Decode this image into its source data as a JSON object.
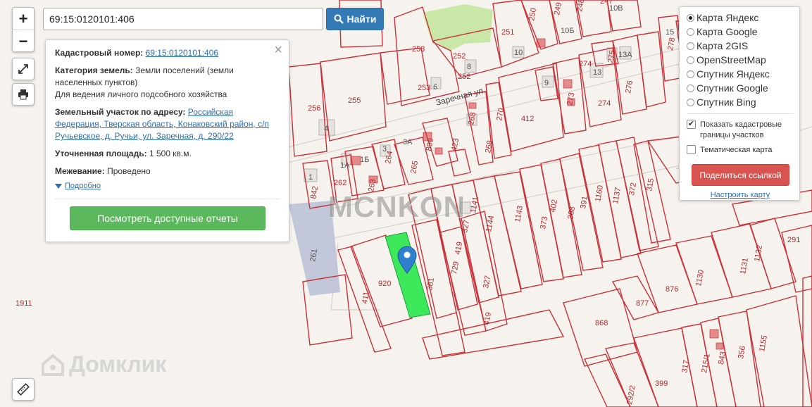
{
  "search": {
    "value": "69:15:0120101:406",
    "button_label": "Найти"
  },
  "zoom": {
    "in_label": "+",
    "out_label": "−"
  },
  "info": {
    "cadastral_label": "Кадастровый номер:",
    "cadastral_value": "69:15:0120101:406",
    "category_label": "Категория земель:",
    "category_value": "Земли поселений (земли населенных пунктов)",
    "use_value": "Для ведения личного подсобного хозяйства",
    "address_label": "Земельный участок по адресу:",
    "address_value": "Российская Федерация, Тверская область, Конаковский район, с/п Ручьевское, д. Ручьи, ул. Заречная, д. 290/22",
    "area_label": "Уточненная площадь:",
    "area_value": "1 500 кв.м.",
    "survey_label": "Межевание:",
    "survey_value": "Проведено",
    "more_label": "Подробно",
    "reports_button": "Посмотреть доступные отчеты",
    "close_symbol": "×"
  },
  "layers": {
    "options": [
      {
        "label": "Карта Яндекс",
        "selected": true
      },
      {
        "label": "Карта Google",
        "selected": false
      },
      {
        "label": "Карта 2GIS",
        "selected": false
      },
      {
        "label": "OpenStreetMap",
        "selected": false
      },
      {
        "label": "Спутник Яндекс",
        "selected": false
      },
      {
        "label": "Спутник Google",
        "selected": false
      },
      {
        "label": "Спутник Bing",
        "selected": false
      }
    ],
    "show_borders_label": "Показать кадастровые границы участков",
    "show_borders_checked": true,
    "thematic_label": "Тематическая карта",
    "thematic_checked": false,
    "share_button": "Поделиться ссылкой",
    "configure_link": "Настроить карту"
  },
  "map": {
    "street_label": "Заречная ул.",
    "watermark": "MCNKON",
    "brand": "Домклик",
    "parcel_labels": [
      "69:15:0120101:406"
    ],
    "numbers": {
      "n253": "253",
      "n252a": "252",
      "n252b": "252",
      "n8": "8",
      "n251": "251",
      "n250": "250",
      "n249": "249",
      "n10b": "10Б",
      "n248": "248",
      "n247": "247",
      "n10v": "10В",
      "n10": "10",
      "n15": "15",
      "n278": "278",
      "n256": "256",
      "n255": "255",
      "n4": "4",
      "n253b": "253",
      "n6": "6",
      "n270": "270",
      "n412": "412",
      "n9": "9",
      "n273": "273",
      "n274a": "274",
      "n274b": "274",
      "n13": "13",
      "n275": "275",
      "n13a": "13А",
      "n276": "276",
      "n268a": "268",
      "n268b": "268",
      "n890": "890",
      "n423": "423",
      "n3": "3",
      "n3a": "3А",
      "n264": "264",
      "n265": "265",
      "n1a": "1А",
      "n1b": "1Б",
      "n1": "1",
      "n842": "842",
      "n262": "262",
      "n263": "263",
      "n315": "315",
      "n372": "372",
      "n1137": "1137",
      "n1160": "1160",
      "n391": "391",
      "n368": "368",
      "n402": "402",
      "n373": "373",
      "n1143": "1143",
      "n1144": "1144",
      "n327a": "327",
      "n1141": "1141",
      "n261": "261",
      "n920": "920",
      "n411": "411",
      "n381": "381",
      "n729": "729",
      "n419a": "419",
      "n419b": "419",
      "n327b": "327",
      "n291": "291",
      "n1132": "1132",
      "n1131": "1131",
      "n1130": "1130",
      "n876": "876",
      "n877": "877",
      "n868": "868",
      "n1911": "1911",
      "n843": "843",
      "n356": "356",
      "n1155": "1155",
      "n215": "215/1",
      "n317": "317",
      "n399": "399",
      "n292": "292/2"
    }
  },
  "colors": {
    "parcel_border": "#c8323a",
    "selected_fill": "#3de85a",
    "marker": "#2f7fcf",
    "search_btn": "#337ab7",
    "reports_btn": "#5cb85c",
    "share_btn": "#d9534f"
  },
  "icons": {
    "search": "search-icon",
    "fullscreen": "fullscreen-icon",
    "print": "print-icon",
    "ruler": "ruler-icon",
    "marker": "map-marker-icon"
  }
}
